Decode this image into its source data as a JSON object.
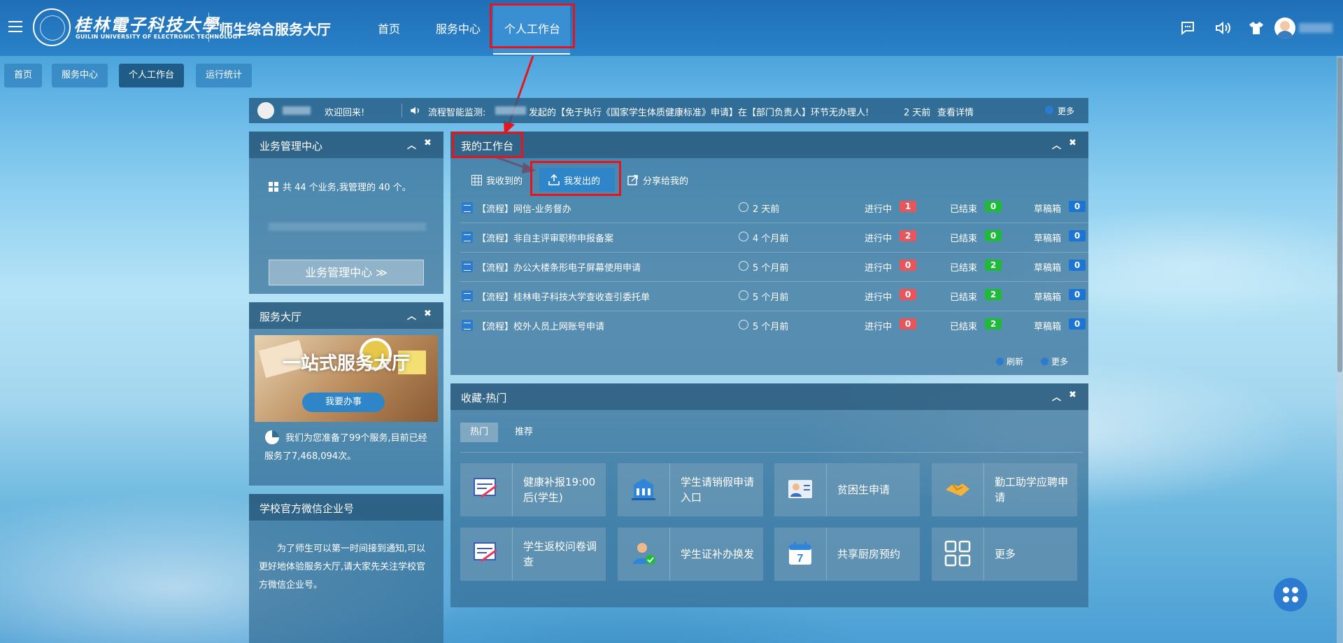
{
  "header": {
    "logo_cn": "桂林電子科技大學",
    "logo_en": "GUILIN UNIVERSITY OF ELECTRONIC TECHNOLOGY",
    "site_title": "师生综合服务大厅",
    "nav": [
      "首页",
      "服务中心",
      "个人工作台"
    ],
    "icons": [
      "chat-icon",
      "speaker-icon",
      "tshirt-icon"
    ]
  },
  "tabs": [
    "首页",
    "服务中心",
    "个人工作台",
    "运行统计"
  ],
  "notice": {
    "welcome": "欢迎回来!",
    "monitor_prefix": "流程智能监测:",
    "monitor_text": "发起的【免于执行《国家学生体质健康标准》申请】在【部门负责人】环节无办理人!",
    "time": "2 天前",
    "detail": "查看详情",
    "more": "更多"
  },
  "business": {
    "title": "业务管理中心",
    "summary": "共 44 个业务,我管理的 40 个。",
    "button": "业务管理中心"
  },
  "service_hall": {
    "title": "服务大厅",
    "banner_title": "一站式服务大厅",
    "banner_btn": "我要办事",
    "desc": "我们为您准备了99个服务,目前已经服务了7,468,094次。"
  },
  "wechat": {
    "title": "学校官方微信企业号",
    "desc": "为了师生可以第一时间接到通知,可以更好地体验服务大厅,请大家先关注学校官方微信企业号。"
  },
  "workbench": {
    "title": "我的工作台",
    "subtabs": [
      "我收到的",
      "我发出的",
      "分享给我的"
    ],
    "labels": {
      "running": "进行中",
      "done": "已结束",
      "draft": "草稿箱"
    },
    "rows": [
      {
        "name": "【流程】网信-业务督办",
        "time": "2 天前",
        "running": "1",
        "done": "0",
        "draft": "0"
      },
      {
        "name": "【流程】非自主评审职称申报备案",
        "time": "4 个月前",
        "running": "2",
        "done": "0",
        "draft": "0"
      },
      {
        "name": "【流程】办公大楼条形电子屏幕使用申请",
        "time": "5 个月前",
        "running": "0",
        "done": "2",
        "draft": "0"
      },
      {
        "name": "【流程】桂林电子科技大学查收查引委托单",
        "time": "5 个月前",
        "running": "0",
        "done": "2",
        "draft": "0"
      },
      {
        "name": "【流程】校外人员上网账号申请",
        "time": "5 个月前",
        "running": "0",
        "done": "2",
        "draft": "0"
      }
    ],
    "refresh": "刷新",
    "more": "更多"
  },
  "favorites": {
    "title": "收藏-热门",
    "tabs": [
      "热门",
      "推荐"
    ],
    "tiles": [
      {
        "label": "健康补报19:00后(学生)",
        "icon": "form-pen-icon"
      },
      {
        "label": "学生请销假申请入口",
        "icon": "building-icon"
      },
      {
        "label": "贫困生申请",
        "icon": "id-card-icon"
      },
      {
        "label": "勤工助学应聘申请",
        "icon": "handshake-icon"
      },
      {
        "label": "学生返校问卷调查",
        "icon": "form-pen-icon"
      },
      {
        "label": "学生证补办换发",
        "icon": "user-check-icon"
      },
      {
        "label": "共享厨房预约",
        "icon": "calendar-icon"
      },
      {
        "label": "更多",
        "icon": "grid-icon"
      }
    ],
    "calendar_day": "7"
  },
  "colors": {
    "accent": "#2e86c8",
    "highlight": "#e8141b",
    "badge_red": "#e8555a",
    "badge_green": "#1fba3a",
    "badge_blue": "#1c74d4"
  }
}
